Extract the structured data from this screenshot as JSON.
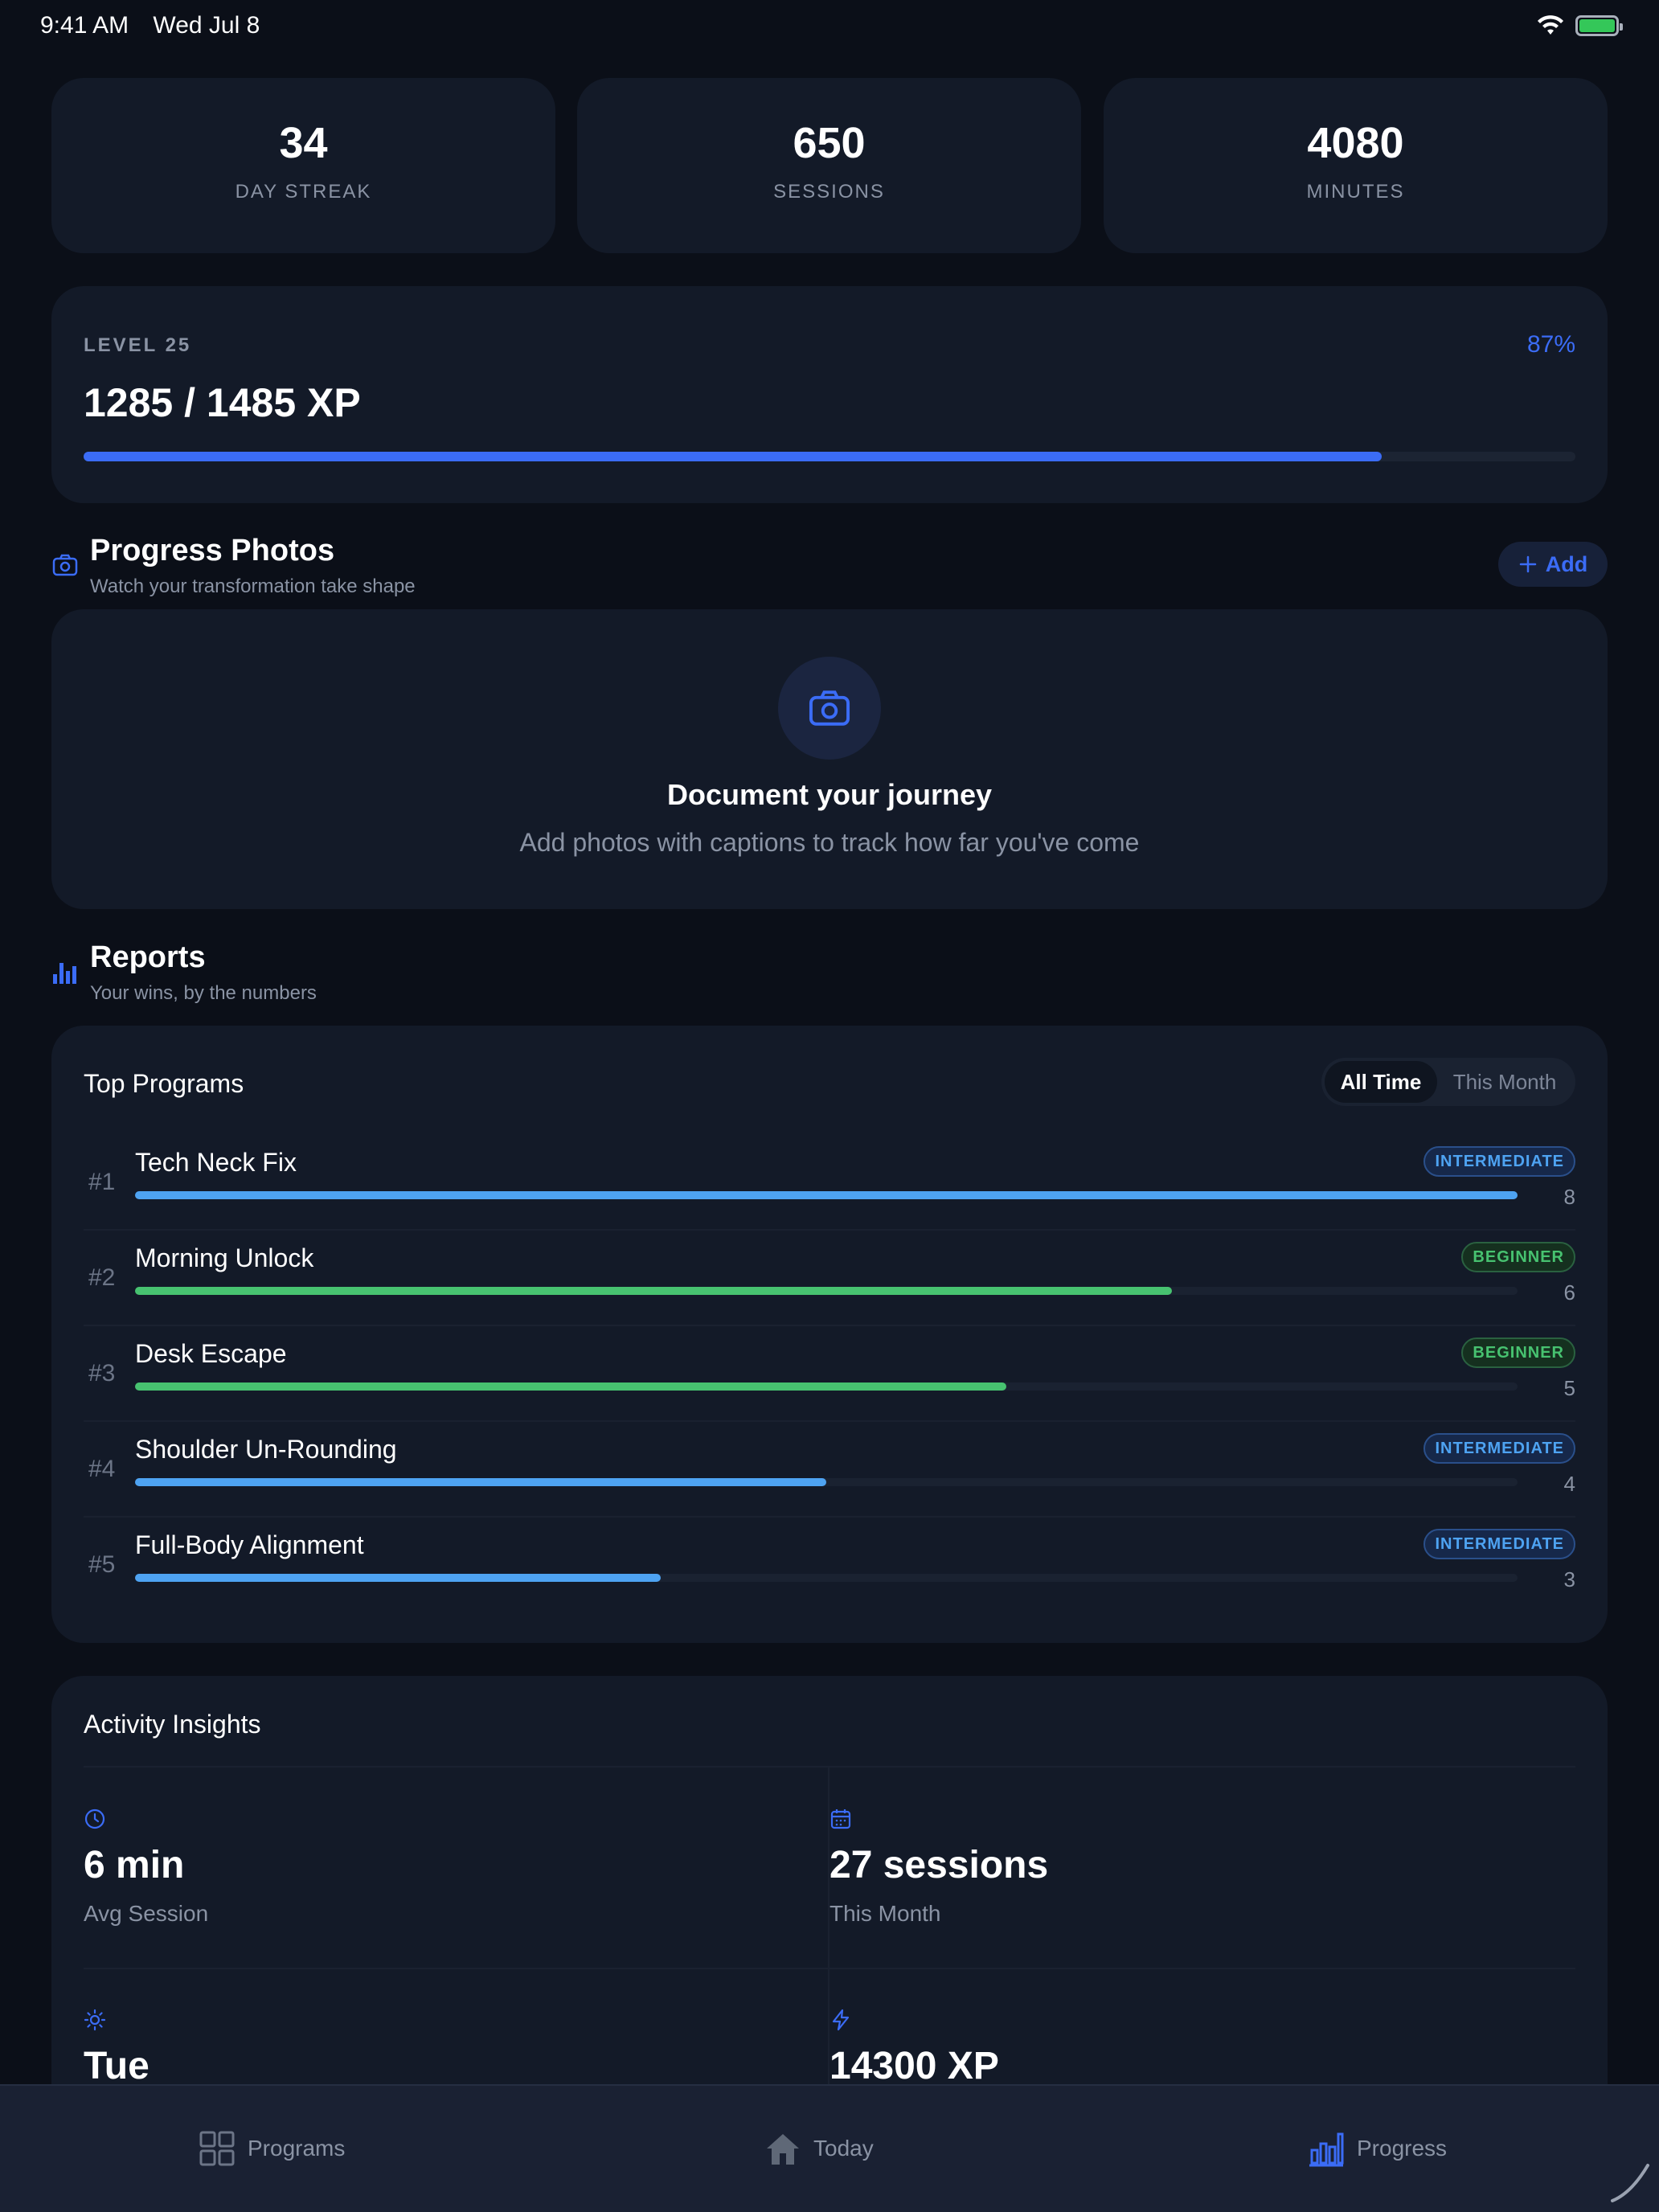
{
  "status_bar": {
    "time": "9:41 AM",
    "date": "Wed Jul 8"
  },
  "stats": [
    {
      "value": "34",
      "label": "DAY STREAK"
    },
    {
      "value": "650",
      "label": "SESSIONS"
    },
    {
      "value": "4080",
      "label": "MINUTES"
    }
  ],
  "level": {
    "label": "LEVEL 25",
    "percent_text": "87%",
    "xp_text": "1285 / 1485 XP",
    "progress": 0.87
  },
  "progress_photos": {
    "title": "Progress Photos",
    "subtitle": "Watch your transformation take shape",
    "add_label": "Add",
    "empty_title": "Document your journey",
    "empty_subtitle": "Add photos with captions to track how far you've come"
  },
  "reports": {
    "title": "Reports",
    "subtitle": "Your wins, by the numbers"
  },
  "top_programs": {
    "title": "Top Programs",
    "segments": [
      "All Time",
      "This Month"
    ],
    "selected_segment": "All Time",
    "items": [
      {
        "rank": "#1",
        "name": "Tech Neck Fix",
        "level": "INTERMEDIATE",
        "count": "8",
        "fraction": 1.0,
        "color": "#4ea3f2"
      },
      {
        "rank": "#2",
        "name": "Morning Unlock",
        "level": "BEGINNER",
        "count": "6",
        "fraction": 0.75,
        "color": "#47c270"
      },
      {
        "rank": "#3",
        "name": "Desk Escape",
        "level": "BEGINNER",
        "count": "5",
        "fraction": 0.63,
        "color": "#47c270"
      },
      {
        "rank": "#4",
        "name": "Shoulder Un-Rounding",
        "level": "INTERMEDIATE",
        "count": "4",
        "fraction": 0.5,
        "color": "#4ea3f2"
      },
      {
        "rank": "#5",
        "name": "Full-Body Alignment",
        "level": "INTERMEDIATE",
        "count": "3",
        "fraction": 0.38,
        "color": "#4ea3f2"
      }
    ]
  },
  "activity_insights": {
    "title": "Activity Insights",
    "items": [
      {
        "icon": "clock-icon",
        "value": "6 min",
        "label": "Avg Session"
      },
      {
        "icon": "calendar-icon",
        "value": "27 sessions",
        "label": "This Month"
      },
      {
        "icon": "sun-icon",
        "value": "Tue",
        "label": ""
      },
      {
        "icon": "lightning-icon",
        "value": "14300 XP",
        "label": ""
      }
    ]
  },
  "tab_bar": {
    "tabs": [
      {
        "label": "Programs",
        "icon": "grid-icon"
      },
      {
        "label": "Today",
        "icon": "home-icon"
      },
      {
        "label": "Progress",
        "icon": "bar-chart-icon"
      }
    ],
    "active": "Progress"
  },
  "colors": {
    "accent": "#3b6cf6",
    "background": "#0b0f18",
    "card": "#131a28"
  }
}
